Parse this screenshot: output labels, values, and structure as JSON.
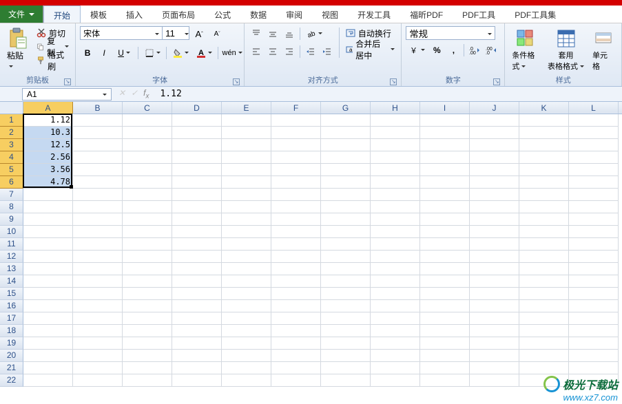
{
  "tabs": {
    "file": "文件",
    "items": [
      "开始",
      "模板",
      "插入",
      "页面布局",
      "公式",
      "数据",
      "审阅",
      "视图",
      "开发工具",
      "福昕PDF",
      "PDF工具",
      "PDF工具集"
    ],
    "active": 0
  },
  "ribbon": {
    "clipboard": {
      "paste": "粘贴",
      "cut": "剪切",
      "copy": "复制",
      "format_painter": "格式刷",
      "label": "剪贴板"
    },
    "font": {
      "name": "宋体",
      "size": "11",
      "label": "字体"
    },
    "align": {
      "wrap": "自动换行",
      "merge": "合并后居中",
      "label": "对齐方式"
    },
    "number": {
      "format": "常规",
      "label": "数字"
    },
    "styles": {
      "cond": "条件格式",
      "table": "套用\n表格格式",
      "cell": "单元格",
      "label": "样式"
    }
  },
  "namebox": "A1",
  "formula": "1.12",
  "columns": [
    "A",
    "B",
    "C",
    "D",
    "E",
    "F",
    "G",
    "H",
    "I",
    "J",
    "K",
    "L"
  ],
  "rows": 22,
  "selection": {
    "col": 0,
    "row_start": 0,
    "row_end": 5
  },
  "data": {
    "A": [
      "1.12",
      "10.3",
      "12.5",
      "2.56",
      "3.56",
      "4.78"
    ]
  },
  "watermark": {
    "line1": "极光下载站",
    "line2": "www.xz7.com"
  }
}
